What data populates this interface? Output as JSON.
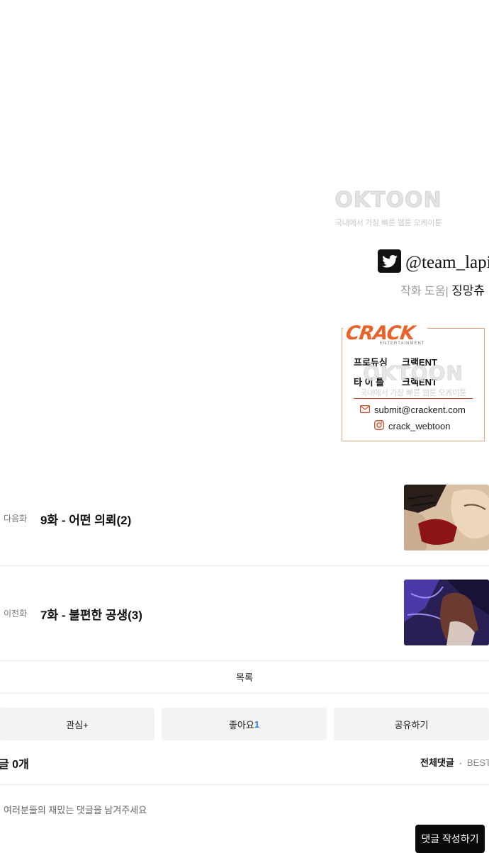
{
  "watermark": {
    "logo": "OKTOON",
    "sub": "국내에서 가장 빠른 웹툰 오케이툰"
  },
  "credits": {
    "twitter_handle": "@team_lapis",
    "assist_label": "작화 도움|",
    "assist_name": "징망츄"
  },
  "crack_card": {
    "logo": "CRACK",
    "logo_sub": "ENTERTAINMENT",
    "rows": [
      {
        "label": "프로듀싱",
        "value": "크랙ENT"
      },
      {
        "label": "타 이 틀",
        "value": "크랙ENT"
      }
    ],
    "email": "submit@crackent.com",
    "instagram": "crack_webtoon"
  },
  "episodes": {
    "next": {
      "kind": "다음화",
      "title": "9화 - 어떤 의뢰(2)"
    },
    "prev": {
      "kind": "이전화",
      "title": "7화 - 불편한 공생(3)"
    }
  },
  "list_label": "목록",
  "actions": {
    "favorite": "관심+",
    "like_label": "좋아요",
    "like_count": "1",
    "share": "공유하기"
  },
  "comments": {
    "count_label": "글 0개",
    "tab_all": "전체댓글",
    "tab_sep": "•",
    "tab_best": "BEST댓",
    "placeholder": "여러분들의 재밌는 댓글을 남겨주세요",
    "write_button": "댓글 작성하기"
  },
  "colors": {
    "accent_like": "#2a7ae2",
    "crack_orange": "#e8622a",
    "write_button_bg": "#0a0a0a"
  }
}
